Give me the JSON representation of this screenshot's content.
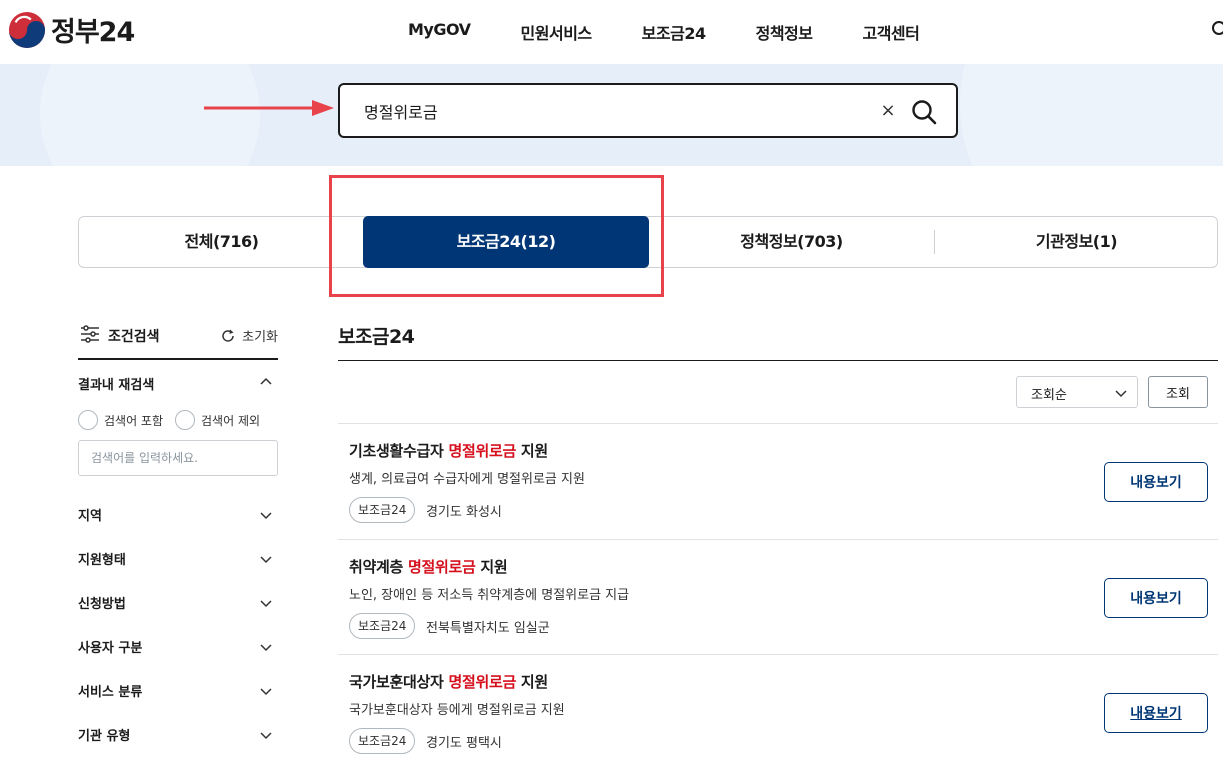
{
  "header": {
    "logo_text": "정부24",
    "nav": [
      "MyGOV",
      "민원서비스",
      "보조금24",
      "정책정보",
      "고객센터"
    ]
  },
  "search": {
    "value": "명절위로금",
    "clear_label": "×"
  },
  "tabs": [
    {
      "label": "전체(716)"
    },
    {
      "label": "보조금24(12)"
    },
    {
      "label": "정책정보(703)"
    },
    {
      "label": "기관정보(1)"
    }
  ],
  "sidebar": {
    "title": "조건검색",
    "reset_label": "초기화",
    "refine_label": "결과내 재검색",
    "options": [
      "검색어 포함",
      "검색어 제외"
    ],
    "input_placeholder": "검색어를 입력하세요.",
    "filters": [
      "지역",
      "지원형태",
      "신청방법",
      "사용자 구분",
      "서비스 분류",
      "기관 유형"
    ]
  },
  "results": {
    "title": "보조금24",
    "sort_value": "조회순",
    "query_button": "조회",
    "items": [
      {
        "title_pre": "기초생활수급자 ",
        "title_hl": "명절위로금",
        "title_post": " 지원",
        "desc": "생계, 의료급여 수급자에게 명절위로금 지원",
        "tag": "보조금24",
        "region": "경기도 화성시",
        "button": "내용보기"
      },
      {
        "title_pre": "취약계층 ",
        "title_hl": "명절위로금",
        "title_post": " 지원",
        "desc": "노인, 장애인 등 저소득 취약계층에 명절위로금 지급",
        "tag": "보조금24",
        "region": "전북특별자치도 임실군",
        "button": "내용보기"
      },
      {
        "title_pre": "국가보훈대상자 ",
        "title_hl": "명절위로금",
        "title_post": " 지원",
        "desc": "국가보훈대상자 등에게 명절위로금 지원",
        "tag": "보조금24",
        "region": "경기도 평택시",
        "button": "내용보기"
      }
    ]
  },
  "colors": {
    "primary": "#003675",
    "highlight_text": "#d50f1c",
    "annotation": "#e8434a",
    "band": "#e5eef9"
  }
}
